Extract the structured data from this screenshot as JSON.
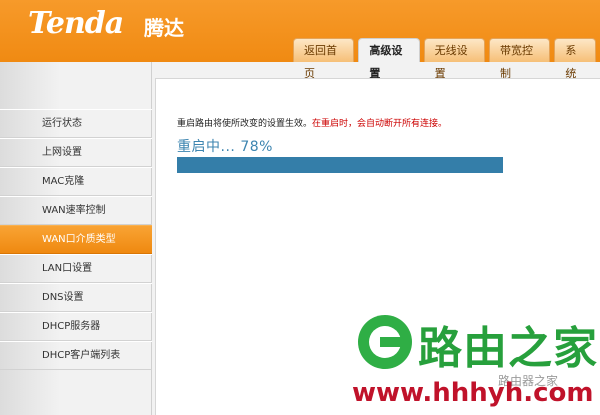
{
  "header": {
    "logo_text": "Tenda",
    "logo_cn": "腾达",
    "tabs": [
      {
        "label": "返回首页"
      },
      {
        "label": "高级设置"
      },
      {
        "label": "无线设置"
      },
      {
        "label": "带宽控制"
      },
      {
        "label": "系统"
      }
    ],
    "active_tab": "高级设置"
  },
  "sidebar": {
    "items": [
      {
        "label": "运行状态"
      },
      {
        "label": "上网设置"
      },
      {
        "label": "MAC克隆"
      },
      {
        "label": "WAN速率控制"
      },
      {
        "label": "WAN口介质类型"
      },
      {
        "label": "LAN口设置"
      },
      {
        "label": "DNS设置"
      },
      {
        "label": "DHCP服务器"
      },
      {
        "label": "DHCP客户端列表"
      }
    ],
    "active_item": "WAN口介质类型"
  },
  "main": {
    "notice_text": "重启路由将使所改变的设置生效。",
    "notice_warning": "在重启时，会自动断开所有连接。",
    "progress_label": "重启中...",
    "progress_value": "78%",
    "progress_fraction": 0.78
  },
  "watermark": {
    "name_cn": "路由之家",
    "url": "www.hhhyh.com",
    "sub_text": "路由器之家"
  },
  "colors": {
    "header_orange": "#f08a12",
    "active_orange": "#f39a22",
    "progress_blue": "#347ea9",
    "warning_red": "#cc0000",
    "watermark_green": "#27a03c",
    "watermark_red": "#c0122a"
  }
}
